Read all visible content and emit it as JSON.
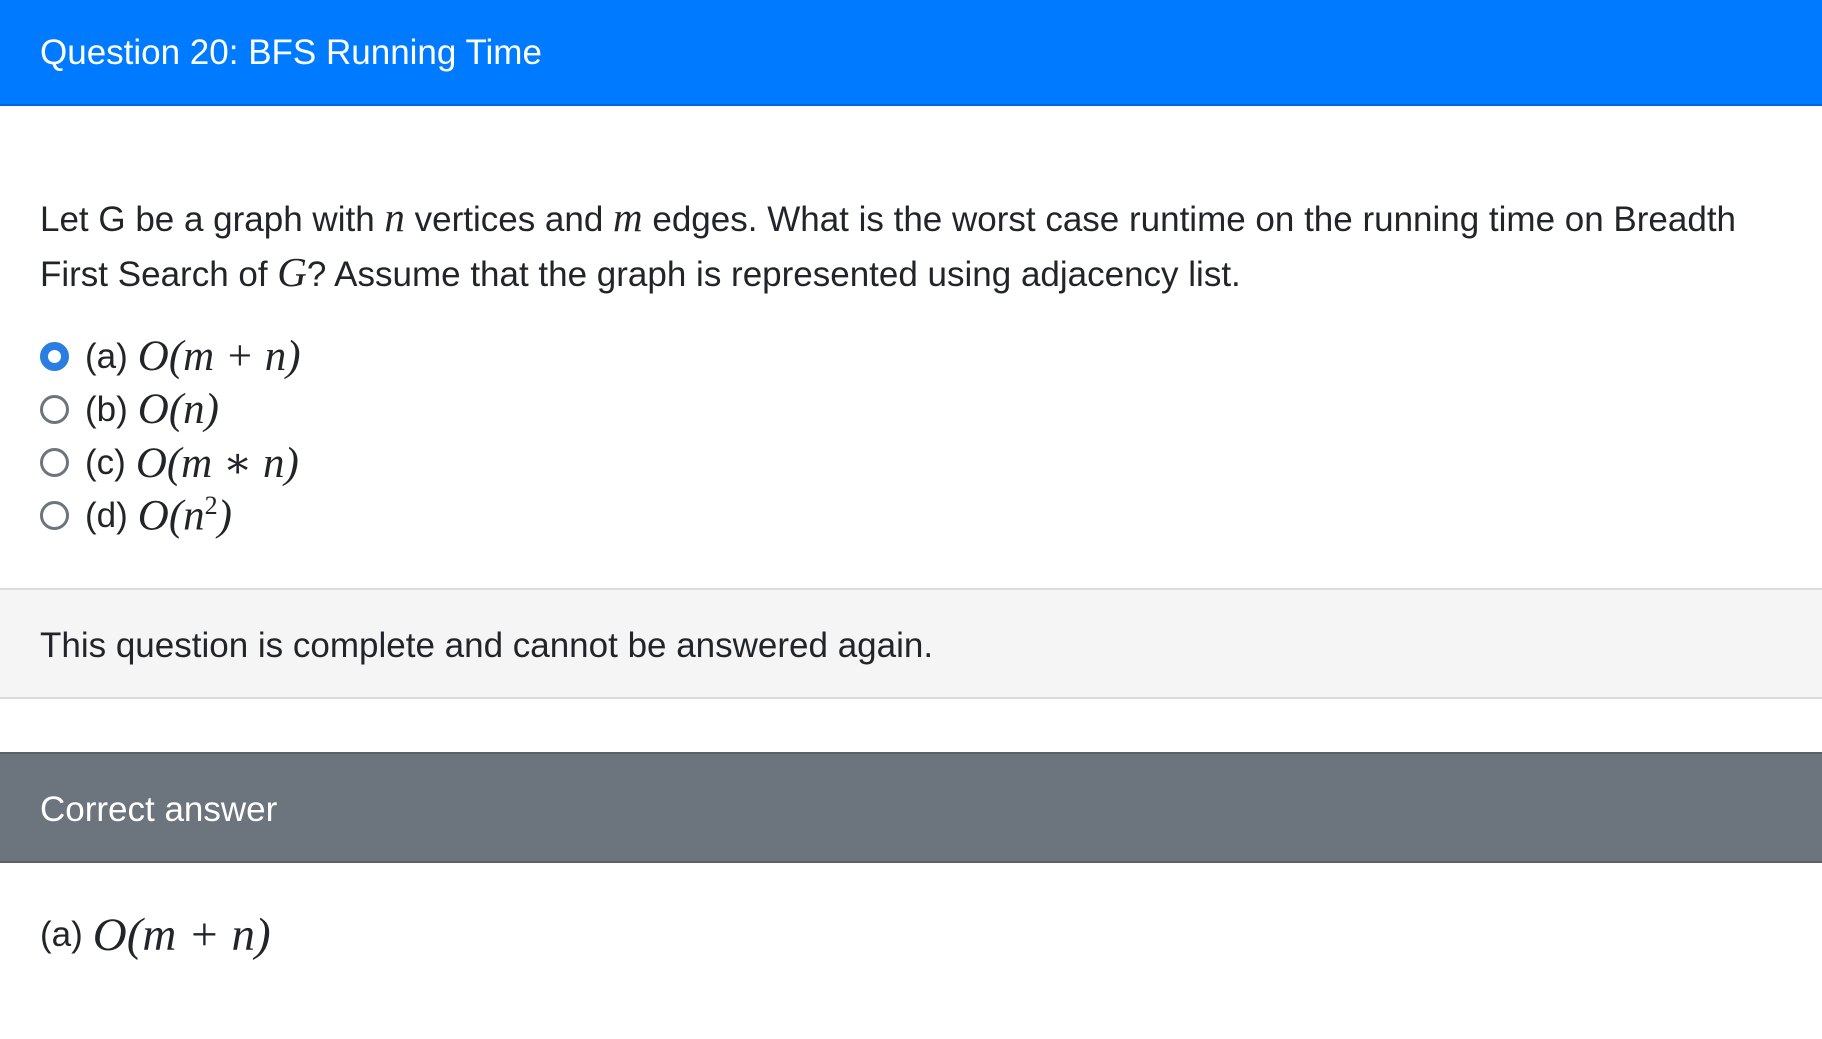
{
  "header": {
    "title": "Question 20: BFS Running Time"
  },
  "question": {
    "text_1": "Let G be a graph with ",
    "var_n": "n",
    "text_2": " vertices and ",
    "var_m": "m",
    "text_3": " edges. What is the worst case runtime on the running time on Breadth First Search of ",
    "var_G": "G",
    "text_4": "? Assume that the graph is represented using adjacency list."
  },
  "options": [
    {
      "label": "(a)",
      "math": "O(m + n)",
      "selected": true
    },
    {
      "label": "(b)",
      "math": "O(n)",
      "selected": false
    },
    {
      "label": "(c)",
      "math": "O(m ∗ n)",
      "selected": false
    },
    {
      "label": "(d)",
      "math_base": "O(n",
      "math_sup": "2",
      "math_close": ")",
      "selected": false
    }
  ],
  "status": {
    "text": "This question is complete and cannot be answered again."
  },
  "correct": {
    "header": "Correct answer",
    "label": "(a)",
    "math": "O(m + n)"
  },
  "colors": {
    "header_blue": "#007bff",
    "header_gray": "#6c757d",
    "radio_selected": "#2a7de1",
    "status_bg": "#f5f5f5"
  },
  "icons": {
    "selected": "radio-checked-icon",
    "unselected": "radio-unchecked-icon"
  }
}
